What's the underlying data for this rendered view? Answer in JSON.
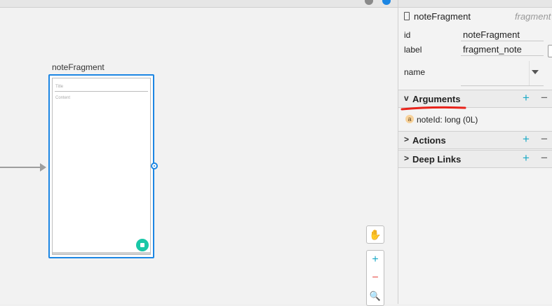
{
  "colors": {
    "accent": "#1c86e3",
    "fab": "#19c7a7",
    "add": "#1aa9c6",
    "remove_zoom": "#e8534e",
    "annotation": "#e8221a",
    "arg_badge": "#f7d29b"
  },
  "canvas": {
    "fragment_name": "noteFragment",
    "preview": {
      "title_hint": "Title",
      "content_hint": "Content"
    },
    "tools": {
      "pan_icon": "hand-icon",
      "zoom_in": "+",
      "zoom_out": "−",
      "zoom_fit_icon": "magnifier-icon"
    }
  },
  "properties": {
    "header": {
      "icon": "device-icon",
      "name": "noteFragment",
      "type": "fragment"
    },
    "fields": [
      {
        "label": "id",
        "value": "noteFragment"
      },
      {
        "label": "label",
        "value": "fragment_note"
      },
      {
        "label": "name",
        "value": ""
      }
    ],
    "sections": [
      {
        "title": "Arguments",
        "expanded": true,
        "chevron": "v",
        "add": "+",
        "remove": "−"
      },
      {
        "title": "Actions",
        "expanded": false,
        "chevron": ">",
        "add": "+",
        "remove": "−"
      },
      {
        "title": "Deep Links",
        "expanded": false,
        "chevron": ">",
        "add": "+",
        "remove": "−"
      }
    ],
    "arguments": [
      {
        "badge": "a",
        "text": "noteId: long (0L)"
      }
    ]
  }
}
